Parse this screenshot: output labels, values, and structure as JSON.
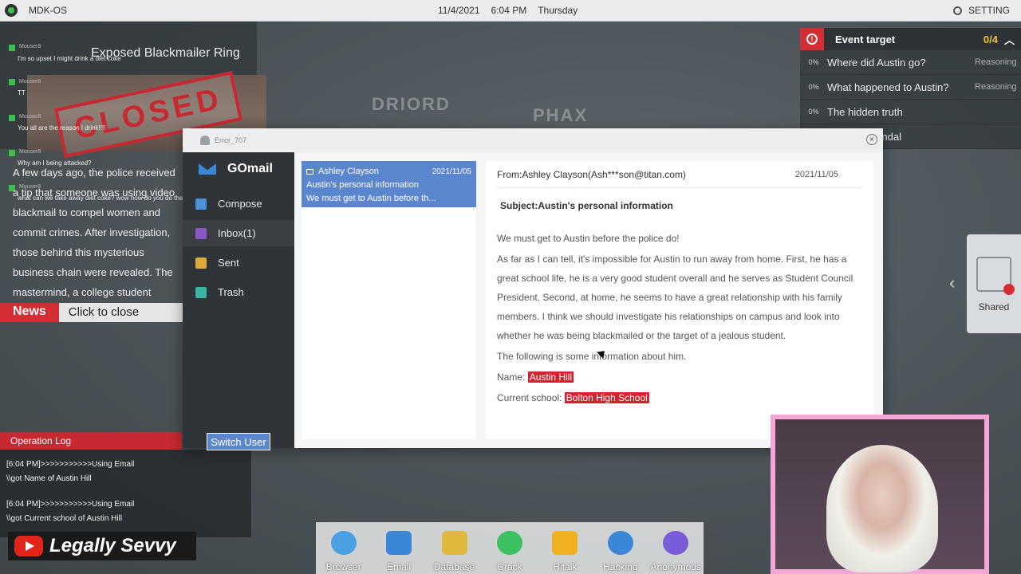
{
  "topbar": {
    "os_name": "MDK-OS",
    "date": "11/4/2021",
    "time": "6:04 PM",
    "weekday": "Thursday",
    "settings_label": "SETTING"
  },
  "map": {
    "labels": [
      "DRIORD",
      "PHAX"
    ]
  },
  "news": {
    "headline": "Exposed Blackmailer Ring",
    "stamp": "CLOSED",
    "body": "A few days ago, the police received a tip that someone was using video blackmail to compel women and commit crimes. After investigation, those behind this mysterious business chain were revealed. The mastermind, a college student named Mason Tone",
    "tag": "News",
    "close_label": "Click to close"
  },
  "chat": [
    {
      "user": "Mouser8",
      "text": "I'm so upset I might drink a diet coke"
    },
    {
      "user": "Mouser8",
      "text": "TT"
    },
    {
      "user": "Mouser8",
      "text": "You all are the reason I drink!!!!"
    },
    {
      "user": "Mouser8",
      "text": "Why am I being attacked?"
    },
    {
      "user": "Mouser8",
      "text": "what can we take away diet coke? wow how do you do that"
    }
  ],
  "oplog": {
    "title": "Operation Log",
    "entries": [
      {
        "line1": "[6:04 PM]>>>>>>>>>>>Using Email",
        "line2": "\\\\got Name of Austin Hill"
      },
      {
        "line1": "[6:04 PM]>>>>>>>>>>>Using Email",
        "line2": "\\\\got Current school of Austin Hill"
      }
    ]
  },
  "youtube": {
    "channel": "Legally Sevvy"
  },
  "event": {
    "title": "Event target",
    "count": "0/4",
    "rows": [
      {
        "pct": "0%",
        "text": "Where did Austin go?",
        "status": "Reasoning"
      },
      {
        "pct": "0%",
        "text": "What happened to Austin?",
        "status": "Reasoning"
      },
      {
        "pct": "0%",
        "text": "The hidden truth",
        "status": ""
      },
      {
        "pct": "",
        "text": "ndal",
        "status": ""
      }
    ]
  },
  "shared": {
    "label": "Shared"
  },
  "email": {
    "window_user": "Error_707",
    "app_name": "GOmail",
    "nav": [
      {
        "label": "Compose",
        "icon": "compose-icon",
        "color": "#4a8fd8"
      },
      {
        "label": "Inbox(1)",
        "icon": "inbox-icon",
        "color": "#8a56c8"
      },
      {
        "label": "Sent",
        "icon": "sent-icon",
        "color": "#e0a83a"
      },
      {
        "label": "Trash",
        "icon": "trash-icon",
        "color": "#3cb4a4"
      }
    ],
    "switch_user": "Switch User",
    "list": [
      {
        "from": "Ashley Clayson",
        "date": "2021/11/05",
        "subject": "Austin's personal information",
        "preview": "We must get to Austin before th..."
      }
    ],
    "reader": {
      "from": "From:Ashley Clayson(Ash***son@titan.com)",
      "date": "2021/11/05",
      "subject": "Subject:Austin's personal information",
      "p1": "We must get to Austin before the police do!",
      "p2": "As far as I can tell, it's impossible for Austin to run away from home. First, he has a great school life, he is a very good student overall and he serves as Student Council President. Second, at home, he seems to have a great relationship with his family members. I think we should investigate his relationships on campus and look into whether he was being blackmailed or the target of a jealous student.",
      "p3": "The following is some information about him.",
      "name_label": "Name:",
      "name_value": "Austin Hill",
      "school_label": "Current school:",
      "school_value": "Bolton High School"
    }
  },
  "dock": [
    {
      "label": "Browser",
      "color": "#4aa0e0"
    },
    {
      "label": "Email",
      "color": "#3c86d8"
    },
    {
      "label": "Database",
      "color": "#e0b840"
    },
    {
      "label": "Crack",
      "color": "#3cc060"
    },
    {
      "label": "Hitalk",
      "color": "#f0b020"
    },
    {
      "label": "Hacking",
      "color": "#3c86d8"
    },
    {
      "label": "Anonymous",
      "color": "#7a5cd8"
    }
  ]
}
